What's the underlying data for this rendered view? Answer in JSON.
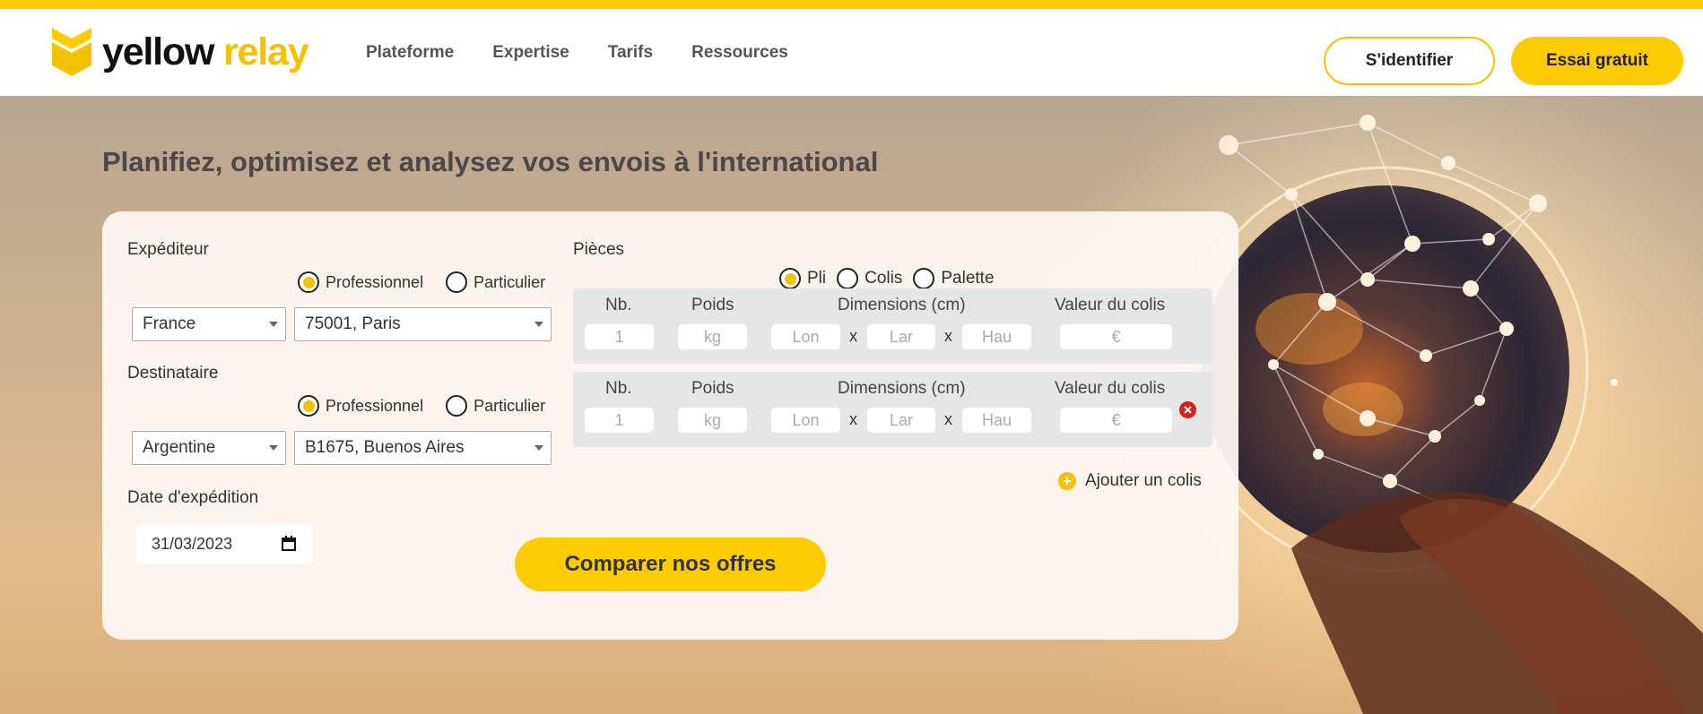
{
  "brand": {
    "word1": "yellow",
    "word2": "relay"
  },
  "nav": {
    "items": [
      "Plateforme",
      "Expertise",
      "Tarifs",
      "Ressources"
    ]
  },
  "header": {
    "login_label": "S'identifier",
    "trial_label": "Essai gratuit"
  },
  "hero": {
    "title": "Planifiez, optimisez et analysez vos envois à l'international"
  },
  "form": {
    "sender": {
      "label": "Expéditeur",
      "type_options": [
        "Professionnel",
        "Particulier"
      ],
      "type_selected": "Professionnel",
      "country": "France",
      "city": "75001, Paris"
    },
    "recipient": {
      "label": "Destinataire",
      "type_options": [
        "Professionnel",
        "Particulier"
      ],
      "type_selected": "Professionnel",
      "country": "Argentine",
      "city": "B1675, Buenos Aires"
    },
    "date": {
      "label": "Date d'expédition",
      "value": "31/03/2023"
    },
    "pieces": {
      "label": "Pièces",
      "type_options": [
        "Pli",
        "Colis",
        "Palette"
      ],
      "type_selected": "Pli",
      "headers": {
        "nb": "Nb.",
        "weight": "Poids",
        "dimensions": "Dimensions (cm)",
        "value": "Valeur du colis"
      },
      "placeholders": {
        "nb": "1",
        "weight": "kg",
        "length": "Lon",
        "width": "Lar",
        "height": "Hau",
        "value": "€"
      },
      "separator": "x",
      "add_label": "Ajouter un colis"
    },
    "submit_label": "Comparer nos offres"
  },
  "colors": {
    "accent": "#ffcb05",
    "brand_yellow": "#f2c200",
    "remove_red": "#d8201f",
    "headline": "#4b4848"
  }
}
